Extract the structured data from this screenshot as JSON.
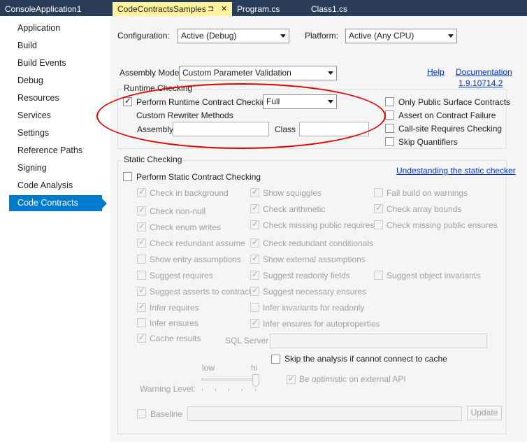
{
  "tabs": [
    {
      "label": "ConsoleApplication1",
      "active": false
    },
    {
      "label": "CodeContractsSamples",
      "active": true,
      "pin_glyph": "⊐",
      "close_glyph": "✕"
    },
    {
      "label": "Program.cs",
      "active": false
    },
    {
      "label": "Class1.cs",
      "active": false
    }
  ],
  "nav": {
    "items": [
      "Application",
      "Build",
      "Build Events",
      "Debug",
      "Resources",
      "Services",
      "Settings",
      "Reference Paths",
      "Signing",
      "Code Analysis",
      "Code Contracts"
    ],
    "selected": "Code Contracts"
  },
  "config": {
    "configuration_label": "Configuration:",
    "configuration_value": "Active (Debug)",
    "platform_label": "Platform:",
    "platform_value": "Active (Any CPU)"
  },
  "assembly_mode": {
    "label": "Assembly Mode:",
    "value": "Custom Parameter Validation",
    "help_link": "Help",
    "documentation_link": "Documentation",
    "version_link": "1.9.10714.2"
  },
  "runtime_checking": {
    "title": "Runtime Checking",
    "perform_label": "Perform Runtime Contract Checking",
    "perform_checked": true,
    "level_value": "Full",
    "rewriter_heading": "Custom Rewriter Methods",
    "assembly_label": "Assembly",
    "assembly_value": "",
    "class_label": "Class",
    "class_value": "",
    "options": [
      {
        "label": "Only Public Surface Contracts",
        "checked": false
      },
      {
        "label": "Assert on Contract Failure",
        "checked": false
      },
      {
        "label": "Call-site Requires Checking",
        "checked": false
      },
      {
        "label": "Skip Quantifiers",
        "checked": false
      }
    ]
  },
  "static_checking": {
    "title": "Static Checking",
    "perform_label": "Perform Static Contract Checking",
    "perform_checked": false,
    "understanding_link": "Undestanding the static checker",
    "col1": [
      {
        "label": "Check in background",
        "checked": true
      },
      {
        "label": "Check non-null",
        "checked": true
      },
      {
        "label": "Check enum writes",
        "checked": true
      },
      {
        "label": "Check redundant assume",
        "checked": true
      },
      {
        "label": "Show entry assumptions",
        "checked": false
      },
      {
        "label": "Suggest requires",
        "checked": false
      },
      {
        "label": "Suggest asserts to contracts",
        "checked": true
      },
      {
        "label": "Infer requires",
        "checked": true
      },
      {
        "label": "Infer ensures",
        "checked": false
      },
      {
        "label": "Cache results",
        "checked": true
      }
    ],
    "col2": [
      {
        "label": "Show squiggles",
        "checked": true
      },
      {
        "label": "Check arithmetic",
        "checked": true
      },
      {
        "label": "Check missing public requires",
        "checked": true
      },
      {
        "label": "Check redundant conditionals",
        "checked": true
      },
      {
        "label": "Show external assumptions",
        "checked": true
      },
      {
        "label": "Suggest readonly fields",
        "checked": true
      },
      {
        "label": "Suggest necessary ensures",
        "checked": true
      },
      {
        "label": "Infer invariants for readonly",
        "checked": false
      },
      {
        "label": "Infer ensures for autoproperties",
        "checked": true
      }
    ],
    "col3": [
      {
        "label": "Fail build on warnings",
        "checked": false
      },
      {
        "label": "Check array bounds",
        "checked": true
      },
      {
        "label": "Check missing public ensures",
        "checked": false
      },
      {
        "label": "Suggest object invariants",
        "checked": false
      }
    ],
    "sql_server_label": "SQL Server",
    "sql_server_value": "",
    "skip_cache_label": "Skip the analysis if cannot connect to cache",
    "skip_cache_checked": false,
    "slider_low": "low",
    "slider_high": "hi",
    "warning_level_label": "Warning Level:",
    "warning_level_fraction": 1.0,
    "be_optimistic_label": "Be optimistic on external API",
    "be_optimistic_checked": true,
    "baseline_label": "Baseline",
    "baseline_checked": false,
    "baseline_value": "",
    "update_button": "Update"
  },
  "colors": {
    "tabstrip": "#2b3c59",
    "active_tab": "#fff29d",
    "nav_selected": "#007acc",
    "panel_bg": "#f5f5f5",
    "link": "#0033cc",
    "annotation": "#e10000"
  }
}
